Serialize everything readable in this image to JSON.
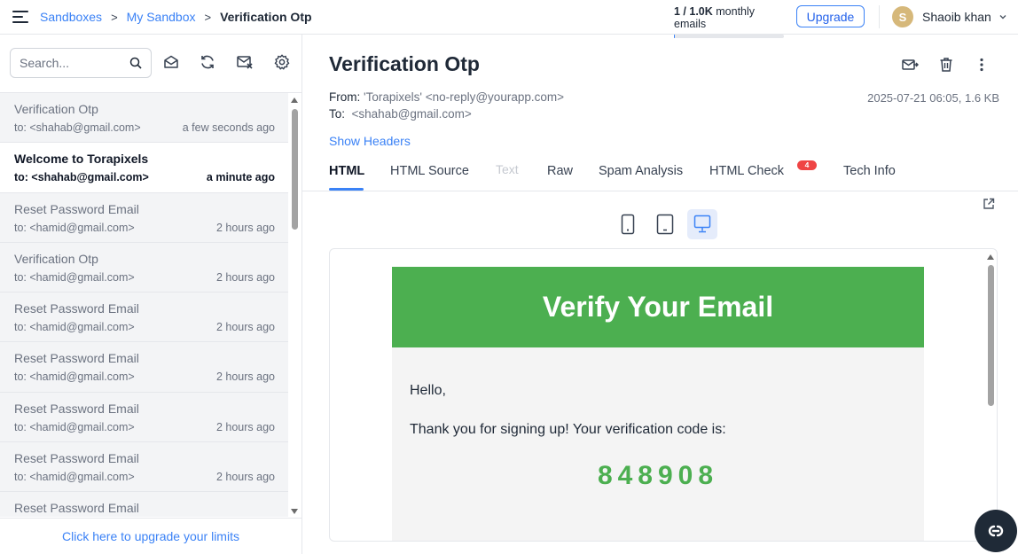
{
  "header": {
    "breadcrumbs": [
      "Sandboxes",
      "My Sandbox",
      "Verification Otp"
    ],
    "separator": ">",
    "quota": {
      "used": "1 / 1.0K",
      "suffix": "monthly emails",
      "used_fraction": 0.001
    },
    "upgrade_label": "Upgrade",
    "user": {
      "initial": "S",
      "name": "Shaoib khan",
      "avatar_color": "#d6b87a"
    }
  },
  "sidebar": {
    "search_placeholder": "Search...",
    "toolbar_icons": [
      "mark-read-icon",
      "refresh-icon",
      "clear-inbox-icon",
      "settings-icon"
    ],
    "messages": [
      {
        "subject": "Verification Otp",
        "to": "to: <shahab@gmail.com>",
        "time": "a few seconds ago",
        "unread": false
      },
      {
        "subject": "Welcome to Torapixels",
        "to": "to: <shahab@gmail.com>",
        "time": "a minute ago",
        "unread": true
      },
      {
        "subject": "Reset Password Email",
        "to": "to: <hamid@gmail.com>",
        "time": "2 hours ago",
        "unread": false
      },
      {
        "subject": "Verification Otp",
        "to": "to: <hamid@gmail.com>",
        "time": "2 hours ago",
        "unread": false
      },
      {
        "subject": "Reset Password Email",
        "to": "to: <hamid@gmail.com>",
        "time": "2 hours ago",
        "unread": false
      },
      {
        "subject": "Reset Password Email",
        "to": "to: <hamid@gmail.com>",
        "time": "2 hours ago",
        "unread": false
      },
      {
        "subject": "Reset Password Email",
        "to": "to: <hamid@gmail.com>",
        "time": "2 hours ago",
        "unread": false
      },
      {
        "subject": "Reset Password Email",
        "to": "to: <hamid@gmail.com>",
        "time": "2 hours ago",
        "unread": false
      },
      {
        "subject": "Reset Password Email",
        "to": "",
        "time": "",
        "unread": false
      }
    ],
    "upgrade_link": "Click here to upgrade your limits"
  },
  "message": {
    "title": "Verification Otp",
    "from_label": "From:",
    "from_value": "'Torapixels' <no-reply@yourapp.com>",
    "to_label": "To:",
    "to_value": "<shahab@gmail.com>",
    "date_size": "2025-07-21 06:05, 1.6 KB",
    "show_headers": "Show Headers",
    "tabs": [
      {
        "label": "HTML",
        "state": "active"
      },
      {
        "label": "HTML Source",
        "state": "normal"
      },
      {
        "label": "Text",
        "state": "disabled"
      },
      {
        "label": "Raw",
        "state": "normal"
      },
      {
        "label": "Spam Analysis",
        "state": "normal"
      },
      {
        "label": "HTML Check",
        "state": "normal",
        "badge": "4"
      },
      {
        "label": "Tech Info",
        "state": "normal"
      }
    ],
    "devices": [
      "mobile-icon",
      "tablet-icon",
      "desktop-icon"
    ],
    "active_device": "desktop"
  },
  "email_preview": {
    "heading": "Verify Your Email",
    "greeting": "Hello,",
    "body": "Thank you for signing up! Your verification code is:",
    "code": "848908",
    "brand_color": "#4caf50"
  },
  "colors": {
    "accent": "#3b82f6",
    "badge": "#ef4444"
  }
}
